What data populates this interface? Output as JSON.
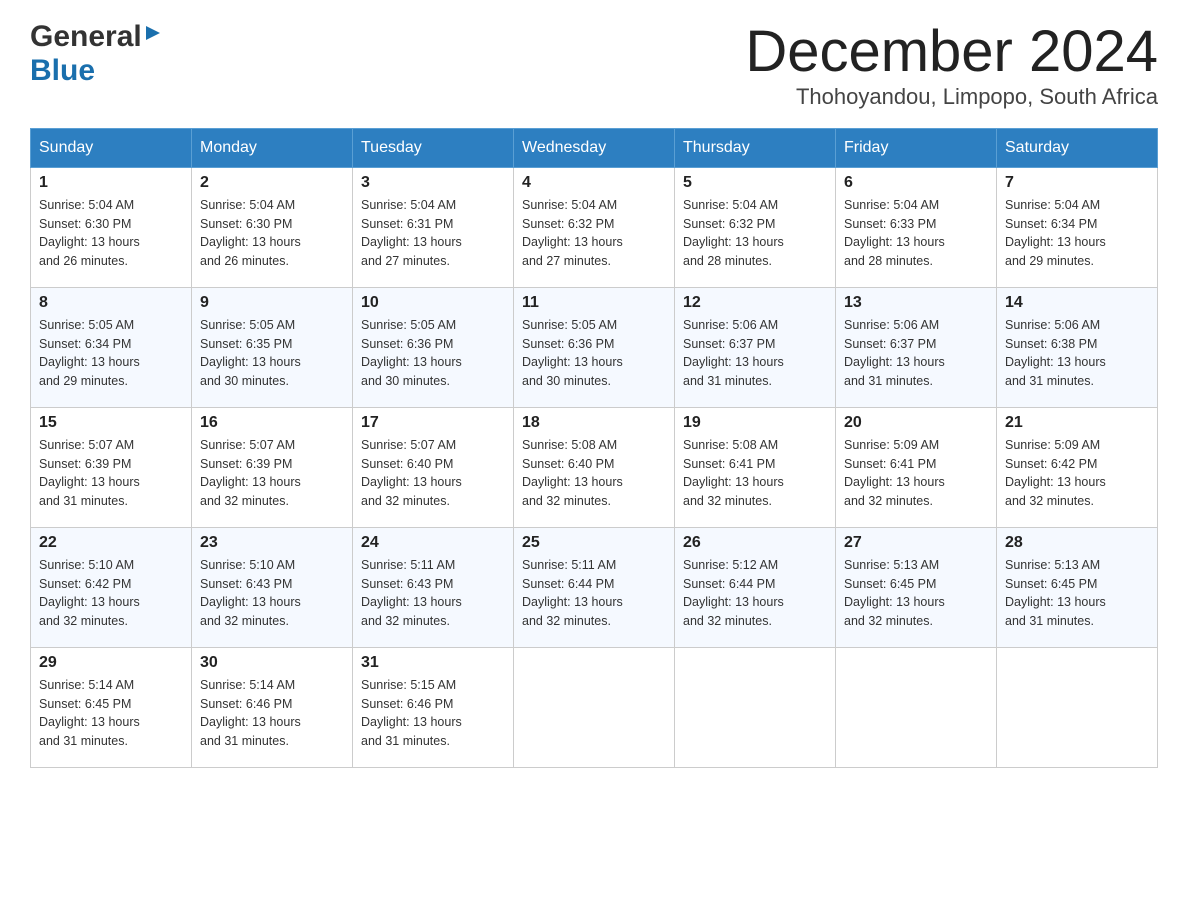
{
  "header": {
    "logo": {
      "general": "General",
      "blue": "Blue"
    },
    "title": "December 2024",
    "location": "Thohoyandou, Limpopo, South Africa"
  },
  "calendar": {
    "days_of_week": [
      "Sunday",
      "Monday",
      "Tuesday",
      "Wednesday",
      "Thursday",
      "Friday",
      "Saturday"
    ],
    "weeks": [
      [
        {
          "day": "1",
          "sunrise": "5:04 AM",
          "sunset": "6:30 PM",
          "daylight": "13 hours and 26 minutes."
        },
        {
          "day": "2",
          "sunrise": "5:04 AM",
          "sunset": "6:30 PM",
          "daylight": "13 hours and 26 minutes."
        },
        {
          "day": "3",
          "sunrise": "5:04 AM",
          "sunset": "6:31 PM",
          "daylight": "13 hours and 27 minutes."
        },
        {
          "day": "4",
          "sunrise": "5:04 AM",
          "sunset": "6:32 PM",
          "daylight": "13 hours and 27 minutes."
        },
        {
          "day": "5",
          "sunrise": "5:04 AM",
          "sunset": "6:32 PM",
          "daylight": "13 hours and 28 minutes."
        },
        {
          "day": "6",
          "sunrise": "5:04 AM",
          "sunset": "6:33 PM",
          "daylight": "13 hours and 28 minutes."
        },
        {
          "day": "7",
          "sunrise": "5:04 AM",
          "sunset": "6:34 PM",
          "daylight": "13 hours and 29 minutes."
        }
      ],
      [
        {
          "day": "8",
          "sunrise": "5:05 AM",
          "sunset": "6:34 PM",
          "daylight": "13 hours and 29 minutes."
        },
        {
          "day": "9",
          "sunrise": "5:05 AM",
          "sunset": "6:35 PM",
          "daylight": "13 hours and 30 minutes."
        },
        {
          "day": "10",
          "sunrise": "5:05 AM",
          "sunset": "6:36 PM",
          "daylight": "13 hours and 30 minutes."
        },
        {
          "day": "11",
          "sunrise": "5:05 AM",
          "sunset": "6:36 PM",
          "daylight": "13 hours and 30 minutes."
        },
        {
          "day": "12",
          "sunrise": "5:06 AM",
          "sunset": "6:37 PM",
          "daylight": "13 hours and 31 minutes."
        },
        {
          "day": "13",
          "sunrise": "5:06 AM",
          "sunset": "6:37 PM",
          "daylight": "13 hours and 31 minutes."
        },
        {
          "day": "14",
          "sunrise": "5:06 AM",
          "sunset": "6:38 PM",
          "daylight": "13 hours and 31 minutes."
        }
      ],
      [
        {
          "day": "15",
          "sunrise": "5:07 AM",
          "sunset": "6:39 PM",
          "daylight": "13 hours and 31 minutes."
        },
        {
          "day": "16",
          "sunrise": "5:07 AM",
          "sunset": "6:39 PM",
          "daylight": "13 hours and 32 minutes."
        },
        {
          "day": "17",
          "sunrise": "5:07 AM",
          "sunset": "6:40 PM",
          "daylight": "13 hours and 32 minutes."
        },
        {
          "day": "18",
          "sunrise": "5:08 AM",
          "sunset": "6:40 PM",
          "daylight": "13 hours and 32 minutes."
        },
        {
          "day": "19",
          "sunrise": "5:08 AM",
          "sunset": "6:41 PM",
          "daylight": "13 hours and 32 minutes."
        },
        {
          "day": "20",
          "sunrise": "5:09 AM",
          "sunset": "6:41 PM",
          "daylight": "13 hours and 32 minutes."
        },
        {
          "day": "21",
          "sunrise": "5:09 AM",
          "sunset": "6:42 PM",
          "daylight": "13 hours and 32 minutes."
        }
      ],
      [
        {
          "day": "22",
          "sunrise": "5:10 AM",
          "sunset": "6:42 PM",
          "daylight": "13 hours and 32 minutes."
        },
        {
          "day": "23",
          "sunrise": "5:10 AM",
          "sunset": "6:43 PM",
          "daylight": "13 hours and 32 minutes."
        },
        {
          "day": "24",
          "sunrise": "5:11 AM",
          "sunset": "6:43 PM",
          "daylight": "13 hours and 32 minutes."
        },
        {
          "day": "25",
          "sunrise": "5:11 AM",
          "sunset": "6:44 PM",
          "daylight": "13 hours and 32 minutes."
        },
        {
          "day": "26",
          "sunrise": "5:12 AM",
          "sunset": "6:44 PM",
          "daylight": "13 hours and 32 minutes."
        },
        {
          "day": "27",
          "sunrise": "5:13 AM",
          "sunset": "6:45 PM",
          "daylight": "13 hours and 32 minutes."
        },
        {
          "day": "28",
          "sunrise": "5:13 AM",
          "sunset": "6:45 PM",
          "daylight": "13 hours and 31 minutes."
        }
      ],
      [
        {
          "day": "29",
          "sunrise": "5:14 AM",
          "sunset": "6:45 PM",
          "daylight": "13 hours and 31 minutes."
        },
        {
          "day": "30",
          "sunrise": "5:14 AM",
          "sunset": "6:46 PM",
          "daylight": "13 hours and 31 minutes."
        },
        {
          "day": "31",
          "sunrise": "5:15 AM",
          "sunset": "6:46 PM",
          "daylight": "13 hours and 31 minutes."
        },
        null,
        null,
        null,
        null
      ]
    ],
    "labels": {
      "sunrise": "Sunrise:",
      "sunset": "Sunset:",
      "daylight": "Daylight:"
    }
  }
}
